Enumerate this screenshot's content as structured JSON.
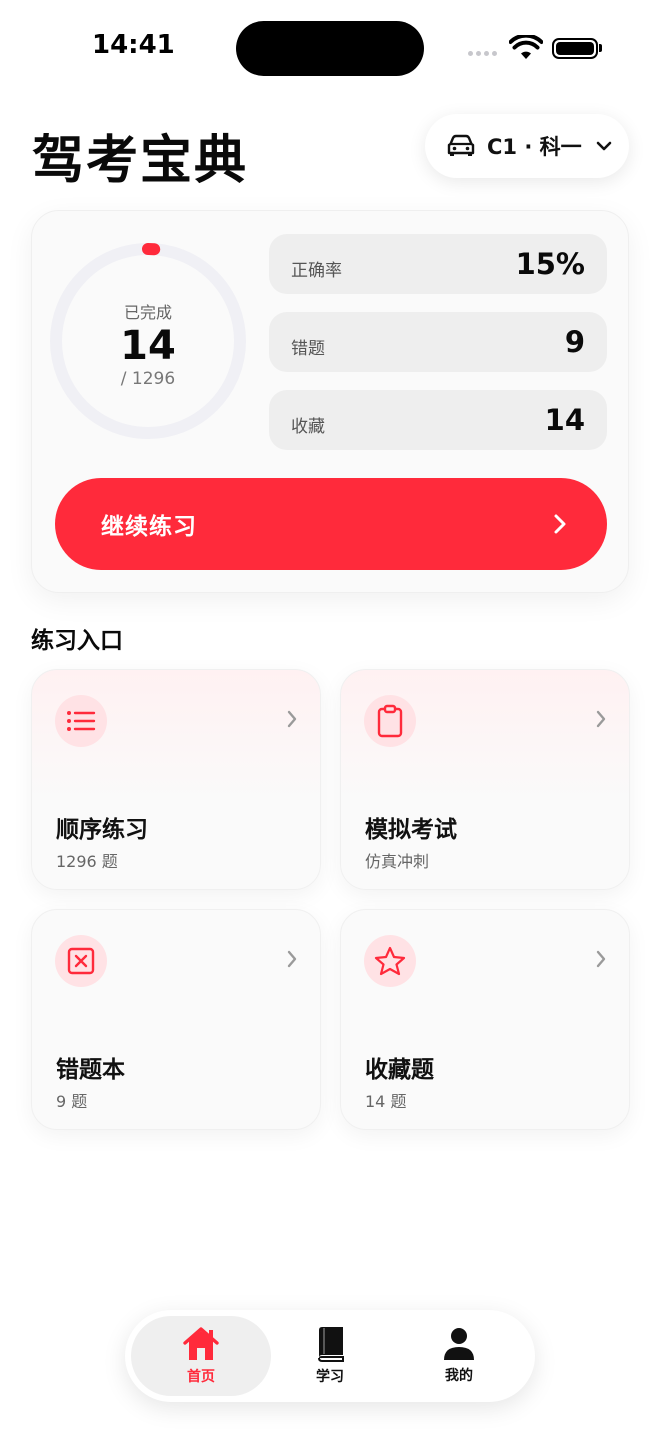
{
  "status_bar": {
    "time": "14:41"
  },
  "header": {
    "title": "驾考宝典",
    "license": {
      "label": "C1 · 科一",
      "icon": "car-icon"
    }
  },
  "progress": {
    "completed_caption": "已完成",
    "completed_count": "14",
    "total_label": "/ 1296",
    "completed_fraction": 0.0108,
    "stats": [
      {
        "label": "正确率",
        "value": "15%"
      },
      {
        "label": "错题",
        "value": "9"
      },
      {
        "label": "收藏",
        "value": "14"
      }
    ],
    "continue_label": "继续练习"
  },
  "section_title": "练习入口",
  "entries": [
    {
      "title": "顺序练习",
      "subtitle": "1296 题",
      "icon": "list-icon"
    },
    {
      "title": "模拟考试",
      "subtitle": "仿真冲刺",
      "icon": "clipboard-icon"
    },
    {
      "title": "错题本",
      "subtitle": "9 题",
      "icon": "x-square-icon"
    },
    {
      "title": "收藏题",
      "subtitle": "14 题",
      "icon": "star-icon"
    }
  ],
  "tabs": [
    {
      "label": "首页",
      "icon": "home-icon",
      "active": true
    },
    {
      "label": "学习",
      "icon": "book-icon",
      "active": false
    },
    {
      "label": "我的",
      "icon": "person-icon",
      "active": false
    }
  ],
  "colors": {
    "accent": "#ff2a3b",
    "accent_soft": "#ffe2e5",
    "ring_track": "#f0f0f5"
  }
}
